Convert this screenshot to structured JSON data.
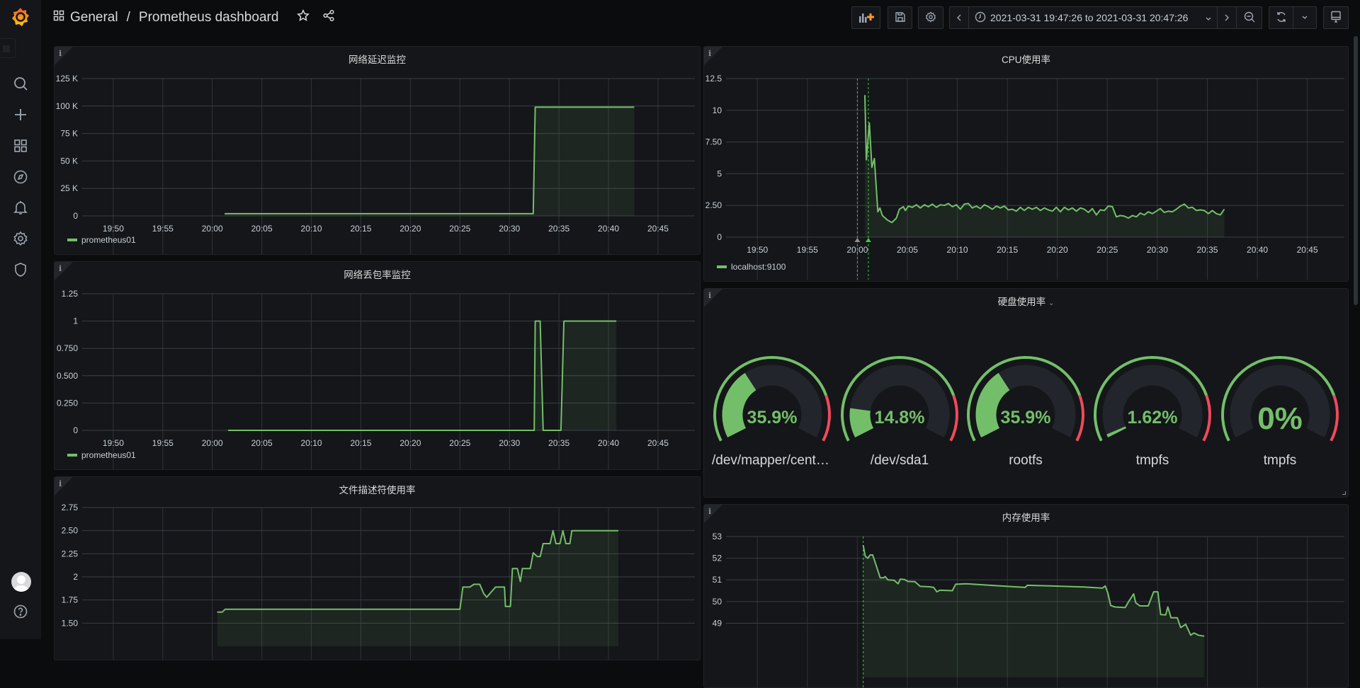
{
  "header": {
    "folder": "General",
    "separator": "/",
    "dashboard_title": "Prometheus dashboard",
    "time_range": "2021-03-31 19:47:26 to 2021-03-31 20:47:26"
  },
  "colors": {
    "series": "#73bf69",
    "threshold_red": "#f2495c",
    "accent": "#ff9830"
  },
  "sidebar": {
    "items": [
      "search-icon",
      "plus-icon",
      "dashboards-icon",
      "explore-icon",
      "alerting-icon",
      "configuration-icon",
      "server-admin-icon"
    ],
    "bottom": [
      "avatar",
      "help-icon"
    ]
  },
  "chart_data": [
    {
      "type": "line",
      "title": "网络延迟监控",
      "xlim": [
        "19:47:26",
        "20:47:26"
      ],
      "x_ticks": [
        "19:50",
        "19:55",
        "20:00",
        "20:05",
        "20:10",
        "20:15",
        "20:20",
        "20:25",
        "20:30",
        "20:35",
        "20:40",
        "20:45"
      ],
      "ylim": [
        0,
        125000
      ],
      "y_ticks": [
        0,
        25000,
        50000,
        75000,
        100000,
        125000
      ],
      "y_tick_labels": [
        "0",
        "25 K",
        "50 K",
        "75 K",
        "100 K",
        "125 K"
      ],
      "grid": true,
      "legend_placement": "bottom-left",
      "series": [
        {
          "name": "prometheus01",
          "points": [
            [
              "20:01:15",
              2000
            ],
            [
              "20:32:24",
              2000
            ],
            [
              "20:32:36",
              99000
            ],
            [
              "20:42:36",
              99000
            ]
          ]
        }
      ]
    },
    {
      "type": "line",
      "title": "网络丢包率监控",
      "xlim": [
        "19:47:26",
        "20:47:26"
      ],
      "x_ticks": [
        "19:50",
        "19:55",
        "20:00",
        "20:05",
        "20:10",
        "20:15",
        "20:20",
        "20:25",
        "20:30",
        "20:35",
        "20:40",
        "20:45"
      ],
      "ylim": [
        0,
        1.25
      ],
      "y_ticks": [
        0,
        0.25,
        0.5,
        0.75,
        1,
        1.25
      ],
      "y_tick_labels": [
        "0",
        "0.250",
        "0.500",
        "0.750",
        "1",
        "1.25"
      ],
      "grid": true,
      "legend_placement": "bottom-left",
      "series": [
        {
          "name": "prometheus01",
          "points": [
            [
              "20:01:36",
              0
            ],
            [
              "20:32:30",
              0
            ],
            [
              "20:32:36",
              1
            ],
            [
              "20:33:06",
              1
            ],
            [
              "20:33:24",
              0
            ],
            [
              "20:35:12",
              0
            ],
            [
              "20:35:30",
              1
            ],
            [
              "20:40:48",
              1
            ]
          ]
        }
      ]
    },
    {
      "type": "line",
      "title": "文件描述符使用率",
      "xlim": [
        "19:47:26",
        "20:47:26"
      ],
      "ylim": [
        1.25,
        2.75
      ],
      "y_ticks": [
        1.5,
        1.75,
        2,
        2.25,
        2.5,
        2.75
      ],
      "y_tick_labels": [
        "1.50",
        "1.75",
        "2",
        "2.25",
        "2.50",
        "2.75"
      ],
      "grid": true,
      "series": [
        {
          "points": [
            [
              "20:00:30",
              1.62
            ],
            [
              "20:01:00",
              1.62
            ],
            [
              "20:01:18",
              1.65
            ],
            [
              "20:25:00",
              1.65
            ],
            [
              "20:25:18",
              1.89
            ],
            [
              "20:26:00",
              1.89
            ],
            [
              "20:26:24",
              1.92
            ],
            [
              "20:27:00",
              1.92
            ],
            [
              "20:27:24",
              1.82
            ],
            [
              "20:27:42",
              1.78
            ],
            [
              "20:28:36",
              1.89
            ],
            [
              "20:29:30",
              1.89
            ],
            [
              "20:29:36",
              1.68
            ],
            [
              "20:30:06",
              1.68
            ],
            [
              "20:30:18",
              2.09
            ],
            [
              "20:30:48",
              2.09
            ],
            [
              "20:31:06",
              1.95
            ],
            [
              "20:31:18",
              2.09
            ],
            [
              "20:32:06",
              2.09
            ],
            [
              "20:32:24",
              2.26
            ],
            [
              "20:32:48",
              2.22
            ],
            [
              "20:33:06",
              2.22
            ],
            [
              "20:33:24",
              2.36
            ],
            [
              "20:34:06",
              2.36
            ],
            [
              "20:34:24",
              2.5
            ],
            [
              "20:34:42",
              2.36
            ],
            [
              "20:35:06",
              2.36
            ],
            [
              "20:35:24",
              2.5
            ],
            [
              "20:35:42",
              2.36
            ],
            [
              "20:36:06",
              2.36
            ],
            [
              "20:36:18",
              2.5
            ],
            [
              "20:41:00",
              2.5
            ]
          ]
        }
      ]
    },
    {
      "type": "area",
      "title": "CPU使用率",
      "xlim": [
        "19:47:26",
        "20:47:26"
      ],
      "x_ticks": [
        "19:50",
        "19:55",
        "20:00",
        "20:05",
        "20:10",
        "20:15",
        "20:20",
        "20:25",
        "20:30",
        "20:35",
        "20:40",
        "20:45"
      ],
      "ylim": [
        0,
        12.5
      ],
      "y_ticks": [
        0,
        2.5,
        5,
        7.5,
        10,
        12.5
      ],
      "y_tick_labels": [
        "0",
        "2.50",
        "5",
        "7.50",
        "10",
        "12.5"
      ],
      "grid": true,
      "legend_placement": "bottom-left",
      "annotations": [
        {
          "time": "20:00:00",
          "color": "#8e8e8e"
        },
        {
          "time": "20:01:06",
          "color": "#37cf37"
        }
      ],
      "series": [
        {
          "name": "localhost:9100",
          "points": [
            [
              "20:00:45",
              11.2
            ],
            [
              "20:00:54",
              6.1
            ],
            [
              "20:01:12",
              9.0
            ],
            [
              "20:01:27",
              5.5
            ],
            [
              "20:01:42",
              6.2
            ],
            [
              "20:02:03",
              2.0
            ],
            [
              "20:02:15",
              2.3
            ],
            [
              "20:02:30",
              1.7
            ],
            [
              "20:03:00",
              1.35
            ],
            [
              "20:03:27",
              1.15
            ],
            [
              "20:03:54",
              1.5
            ],
            [
              "20:04:12",
              2.2
            ],
            [
              "20:04:36",
              2.4
            ],
            [
              "20:04:48",
              2.1
            ],
            [
              "20:05:06",
              2.45
            ],
            [
              "20:05:30",
              2.35
            ],
            [
              "20:05:54",
              2.55
            ],
            [
              "20:06:18",
              2.3
            ],
            [
              "20:06:42",
              2.55
            ],
            [
              "20:07:06",
              2.4
            ],
            [
              "20:07:30",
              2.6
            ],
            [
              "20:07:54",
              2.35
            ],
            [
              "20:08:18",
              2.55
            ],
            [
              "20:08:42",
              2.5
            ],
            [
              "20:09:06",
              2.65
            ],
            [
              "20:09:30",
              2.4
            ],
            [
              "20:09:54",
              2.55
            ],
            [
              "20:10:18",
              2.2
            ],
            [
              "20:10:42",
              2.6
            ],
            [
              "20:11:06",
              2.65
            ],
            [
              "20:11:30",
              2.3
            ],
            [
              "20:11:54",
              2.45
            ],
            [
              "20:12:18",
              2.25
            ],
            [
              "20:12:42",
              2.55
            ],
            [
              "20:13:06",
              2.4
            ],
            [
              "20:13:30",
              2.2
            ],
            [
              "20:13:54",
              2.45
            ],
            [
              "20:14:18",
              2.3
            ],
            [
              "20:14:42",
              2.45
            ],
            [
              "20:15:06",
              2.15
            ],
            [
              "20:15:30",
              2.2
            ],
            [
              "20:15:54",
              2.05
            ],
            [
              "20:16:18",
              2.35
            ],
            [
              "20:16:42",
              2.1
            ],
            [
              "20:17:06",
              2.35
            ],
            [
              "20:17:30",
              2.2
            ],
            [
              "20:17:54",
              2.35
            ],
            [
              "20:18:18",
              2.1
            ],
            [
              "20:18:42",
              2.3
            ],
            [
              "20:19:06",
              2.15
            ],
            [
              "20:19:30",
              2.05
            ],
            [
              "20:19:54",
              2.35
            ],
            [
              "20:20:18",
              2.0
            ],
            [
              "20:20:42",
              2.35
            ],
            [
              "20:21:06",
              2.15
            ],
            [
              "20:21:30",
              2.3
            ],
            [
              "20:21:54",
              2.05
            ],
            [
              "20:22:18",
              2.3
            ],
            [
              "20:22:42",
              2.2
            ],
            [
              "20:23:06",
              1.95
            ],
            [
              "20:23:30",
              2.25
            ],
            [
              "20:23:54",
              1.75
            ],
            [
              "20:24:18",
              2.15
            ],
            [
              "20:24:42",
              2.1
            ],
            [
              "20:25:06",
              2.45
            ],
            [
              "20:25:30",
              2.4
            ],
            [
              "20:25:54",
              1.6
            ],
            [
              "20:26:18",
              1.7
            ],
            [
              "20:26:42",
              1.65
            ],
            [
              "20:27:06",
              1.5
            ],
            [
              "20:27:30",
              1.7
            ],
            [
              "20:27:54",
              1.6
            ],
            [
              "20:28:18",
              1.9
            ],
            [
              "20:28:42",
              1.75
            ],
            [
              "20:29:06",
              2.0
            ],
            [
              "20:29:30",
              1.85
            ],
            [
              "20:29:54",
              2.05
            ],
            [
              "20:30:18",
              2.25
            ],
            [
              "20:30:42",
              1.95
            ],
            [
              "20:31:06",
              2.05
            ],
            [
              "20:31:30",
              2.0
            ],
            [
              "20:31:54",
              2.2
            ],
            [
              "20:32:18",
              2.45
            ],
            [
              "20:32:42",
              2.6
            ],
            [
              "20:33:06",
              2.3
            ],
            [
              "20:33:30",
              2.35
            ],
            [
              "20:33:54",
              2.1
            ],
            [
              "20:34:18",
              2.15
            ],
            [
              "20:34:42",
              2.1
            ],
            [
              "20:35:06",
              1.85
            ],
            [
              "20:35:30",
              2.1
            ],
            [
              "20:35:54",
              1.85
            ],
            [
              "20:36:18",
              1.75
            ],
            [
              "20:36:42",
              2.2
            ]
          ]
        }
      ]
    },
    {
      "type": "area",
      "title": "内存使用率",
      "xlim": [
        "19:47:26",
        "20:47:26"
      ],
      "ylim": [
        46.5,
        53
      ],
      "y_ticks": [
        49,
        50,
        51,
        52,
        53
      ],
      "y_tick_labels": [
        "49",
        "50",
        "51",
        "52",
        "53"
      ],
      "grid": true,
      "annotations": [
        {
          "time": "20:00:35",
          "color": "#37cf37"
        }
      ],
      "series": [
        {
          "points": [
            [
              "20:00:35",
              52.6
            ],
            [
              "20:00:47",
              52.1
            ],
            [
              "20:01:03",
              52.0
            ],
            [
              "20:01:17",
              52.15
            ],
            [
              "20:01:32",
              52.15
            ],
            [
              "20:01:47",
              51.8
            ],
            [
              "20:02:17",
              51.1
            ],
            [
              "20:02:38",
              51.1
            ],
            [
              "20:02:47",
              51.15
            ],
            [
              "20:03:03",
              51.0
            ],
            [
              "20:03:40",
              50.98
            ],
            [
              "20:04:05",
              50.82
            ],
            [
              "20:04:17",
              51.03
            ],
            [
              "20:04:42",
              51.02
            ],
            [
              "20:05:03",
              50.93
            ],
            [
              "20:05:45",
              50.92
            ],
            [
              "20:06:17",
              50.7
            ],
            [
              "20:07:12",
              50.68
            ],
            [
              "20:07:38",
              50.65
            ],
            [
              "20:07:57",
              50.45
            ],
            [
              "20:08:15",
              50.52
            ],
            [
              "20:09:30",
              50.5
            ],
            [
              "20:09:50",
              50.8
            ],
            [
              "20:10:57",
              50.82
            ],
            [
              "20:14:17",
              50.72
            ],
            [
              "20:16:47",
              50.65
            ],
            [
              "20:17:00",
              50.75
            ],
            [
              "20:19:17",
              50.72
            ],
            [
              "20:22:38",
              50.67
            ],
            [
              "20:24:30",
              50.62
            ],
            [
              "20:24:47",
              50.72
            ],
            [
              "20:25:03",
              50.4
            ],
            [
              "20:25:20",
              49.82
            ],
            [
              "20:25:45",
              49.75
            ],
            [
              "20:26:47",
              49.72
            ],
            [
              "20:27:12",
              50.05
            ],
            [
              "20:27:38",
              50.35
            ],
            [
              "20:27:50",
              49.95
            ],
            [
              "20:28:15",
              49.8
            ],
            [
              "20:29:05",
              49.8
            ],
            [
              "20:29:38",
              50.45
            ],
            [
              "20:30:03",
              50.45
            ],
            [
              "20:30:20",
              49.4
            ],
            [
              "20:30:50",
              49.38
            ],
            [
              "20:31:03",
              49.75
            ],
            [
              "20:31:22",
              49.25
            ],
            [
              "20:32:00",
              49.25
            ],
            [
              "20:32:20",
              48.8
            ],
            [
              "20:32:50",
              48.95
            ],
            [
              "20:33:20",
              48.45
            ],
            [
              "20:33:40",
              48.55
            ],
            [
              "20:34:05",
              48.45
            ],
            [
              "20:34:42",
              48.4
            ]
          ]
        }
      ]
    }
  ],
  "gauge_panel": {
    "title": "硬盘使用率",
    "min": 0,
    "max": 100,
    "thresholds": [
      {
        "value": null,
        "color": "#73bf69"
      },
      {
        "value": 80,
        "color": "#f2495c"
      }
    ],
    "gauges": [
      {
        "label": "/dev/mapper/centos...",
        "value": 35.9,
        "display": "35.9%"
      },
      {
        "label": "/dev/sda1",
        "value": 14.8,
        "display": "14.8%"
      },
      {
        "label": "rootfs",
        "value": 35.9,
        "display": "35.9%"
      },
      {
        "label": "tmpfs",
        "value": 1.62,
        "display": "1.62%"
      },
      {
        "label": "tmpfs",
        "value": 0,
        "display": "0%"
      }
    ]
  }
}
